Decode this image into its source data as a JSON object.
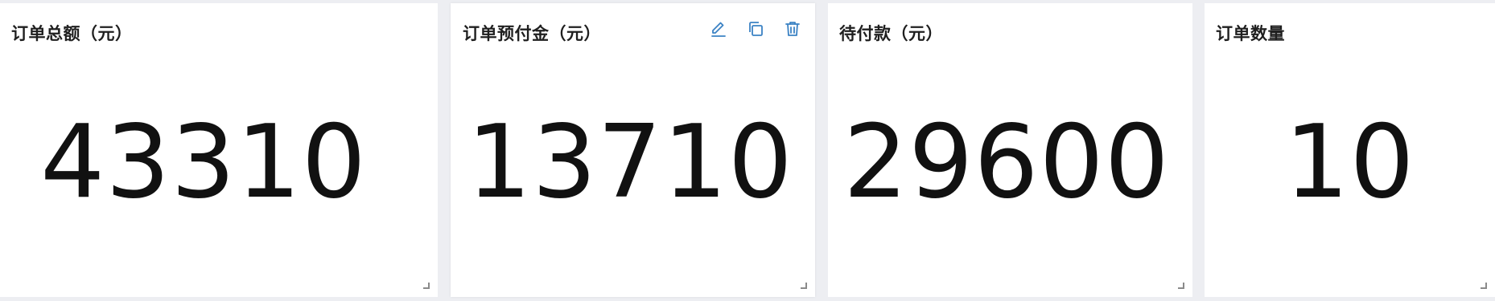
{
  "colors": {
    "background": "#edeef2",
    "card": "#ffffff",
    "icon_accent": "#3b82c4",
    "value_text": "#111111"
  },
  "cards": [
    {
      "title": "订单总额（元）",
      "value": "43310"
    },
    {
      "title": "订单预付金（元）",
      "value": "13710",
      "toolbar": {
        "icons": [
          "edit-icon",
          "copy-icon",
          "delete-icon"
        ]
      }
    },
    {
      "title": "待付款（元）",
      "value": "29600"
    },
    {
      "title": "订单数量",
      "value": "10"
    }
  ]
}
